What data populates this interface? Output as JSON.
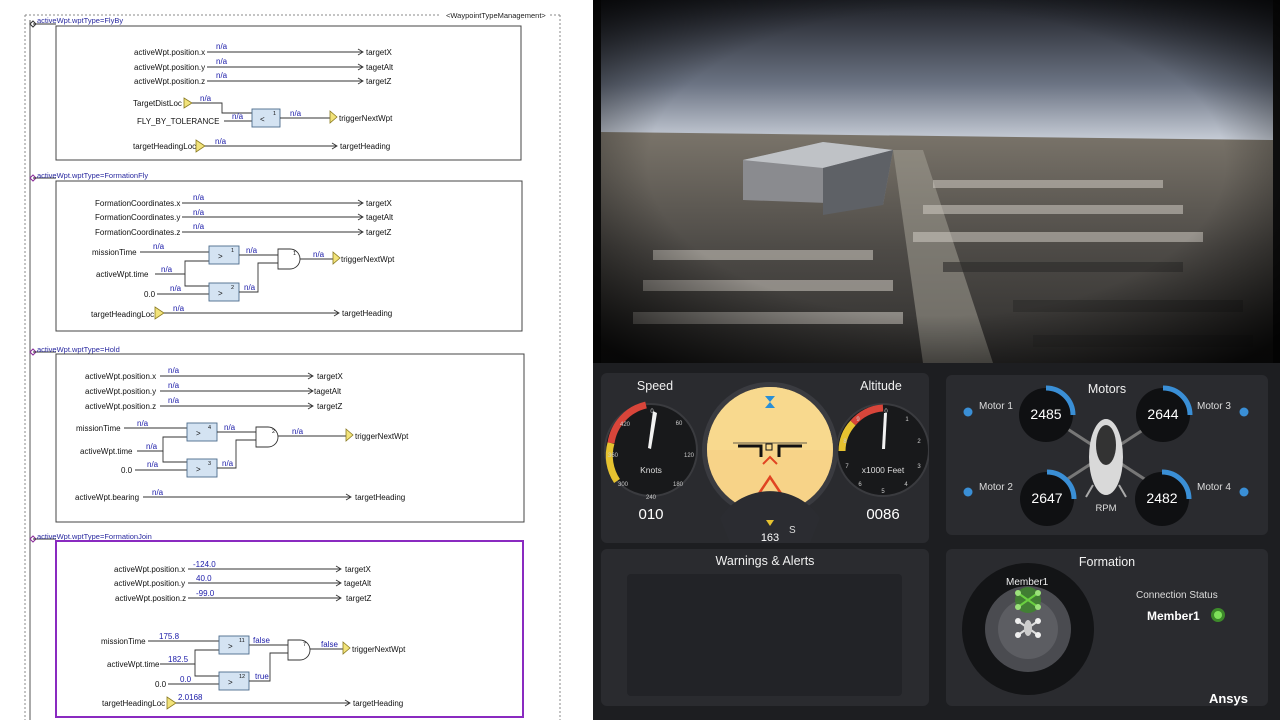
{
  "diagram": {
    "management_label": "<WaypointTypeManagement>",
    "sections": [
      {
        "header": "activeWpt.wptType=FlyBy",
        "inputs": [
          {
            "label": "activeWpt.position.x",
            "value": "n/a",
            "out": "targetX"
          },
          {
            "label": "activeWpt.position.y",
            "value": "n/a",
            "out": "tagetAlt"
          },
          {
            "label": "activeWpt.position.z",
            "value": "n/a",
            "out": "targetZ"
          }
        ],
        "logic": {
          "in1": "TargetDistLoc",
          "in1_value": "n/a",
          "in2": "FLY_BY_TOLERANCE",
          "in2_value": "n/a",
          "block_num": "1",
          "out_value": "n/a",
          "out": "triggerNextWpt"
        },
        "heading": {
          "label": "targetHeadingLoc",
          "value": "n/a",
          "out": "targetHeading"
        }
      },
      {
        "header": "activeWpt.wptType=FormationFly",
        "inputs": [
          {
            "label": "FormationCoordinates.x",
            "value": "n/a",
            "out": "targetX"
          },
          {
            "label": "FormationCoordinates.y",
            "value": "n/a",
            "out": "tagetAlt"
          },
          {
            "label": "FormationCoordinates.z",
            "value": "n/a",
            "out": "targetZ"
          }
        ],
        "logic": {
          "mission_label": "missionTime",
          "mission_value": "n/a",
          "time_label": "activeWpt.time",
          "time_value": "n/a",
          "const_label": "0.0",
          "const_value": "n/a",
          "cmp1": "1",
          "cmp1_value": "n/a",
          "cmp2": "2",
          "cmp2_value": "n/a",
          "and_num": "1",
          "out_value": "n/a",
          "out": "triggerNextWpt"
        },
        "heading": {
          "label": "targetHeadingLoc",
          "value": "n/a",
          "out": "targetHeading"
        }
      },
      {
        "header": "activeWpt.wptType=Hold",
        "inputs": [
          {
            "label": "activeWpt.position.x",
            "value": "n/a",
            "out": "targetX"
          },
          {
            "label": "activeWpt.position.y",
            "value": "n/a",
            "out": "tagetAlt"
          },
          {
            "label": "activeWpt.position.z",
            "value": "n/a",
            "out": "targetZ"
          }
        ],
        "logic": {
          "mission_label": "missionTime",
          "mission_value": "n/a",
          "time_label": "activeWpt.time",
          "time_value": "n/a",
          "const_label": "0.0",
          "const_value": "n/a",
          "cmp1": "4",
          "cmp1_value": "n/a",
          "cmp2": "3",
          "cmp2_value": "n/a",
          "and_num": "2",
          "out_value": "n/a",
          "out": "triggerNextWpt"
        },
        "heading": {
          "label": "activeWpt.bearing",
          "value": "n/a",
          "out": "targetHeading"
        }
      },
      {
        "header": "activeWpt.wptType=FormationJoin",
        "inputs": [
          {
            "label": "activeWpt.position.x",
            "value": "-124.0",
            "out": "targetX"
          },
          {
            "label": "activeWpt.position.y",
            "value": "40.0",
            "out": "tagetAlt"
          },
          {
            "label": "activeWpt.position.z",
            "value": "-99.0",
            "out": "targetZ"
          }
        ],
        "logic": {
          "mission_label": "missionTime",
          "mission_value": "175.8",
          "time_label": "activeWpt.time",
          "time_value": "182.5",
          "const_label": "0.0",
          "const_value": "0.0",
          "cmp1": "11",
          "cmp1_value": "false",
          "cmp2": "12",
          "cmp2_value": "true",
          "and_num": "7",
          "out_value": "false",
          "out": "triggerNextWpt"
        },
        "heading": {
          "label": "targetHeadingLoc",
          "value": "2.0168",
          "out": "targetHeading"
        }
      }
    ]
  },
  "dashboard": {
    "speed": {
      "title": "Speed",
      "unit": "Knots",
      "value": "010",
      "ticks": [
        "0",
        "60",
        "120",
        "180",
        "240",
        "300",
        "360",
        "420"
      ]
    },
    "attitude": {
      "heading": "163",
      "compass_label": "S"
    },
    "altitude": {
      "title": "Altitude",
      "unit": "x1000 Feet",
      "value": "0086",
      "ticks": [
        "0",
        "1",
        "2",
        "3",
        "4",
        "5",
        "6",
        "7",
        "8",
        "9"
      ]
    },
    "motors": {
      "title": "Motors",
      "unit": "RPM",
      "items": [
        {
          "label": "Motor 1",
          "rpm": "2485"
        },
        {
          "label": "Motor 3",
          "rpm": "2644"
        },
        {
          "label": "Motor 2",
          "rpm": "2647"
        },
        {
          "label": "Motor 4",
          "rpm": "2482"
        }
      ]
    },
    "warnings": {
      "title": "Warnings & Alerts"
    },
    "formation": {
      "title": "Formation",
      "member_label": "Member1",
      "status_label": "Connection Status",
      "status_value": "Member1"
    },
    "brand": "Ansys",
    "colors": {
      "accent_blue": "#3a8fd6",
      "gauge_red": "#d8453a",
      "gauge_yellow": "#e6c230",
      "status_green": "#6ad040"
    }
  }
}
